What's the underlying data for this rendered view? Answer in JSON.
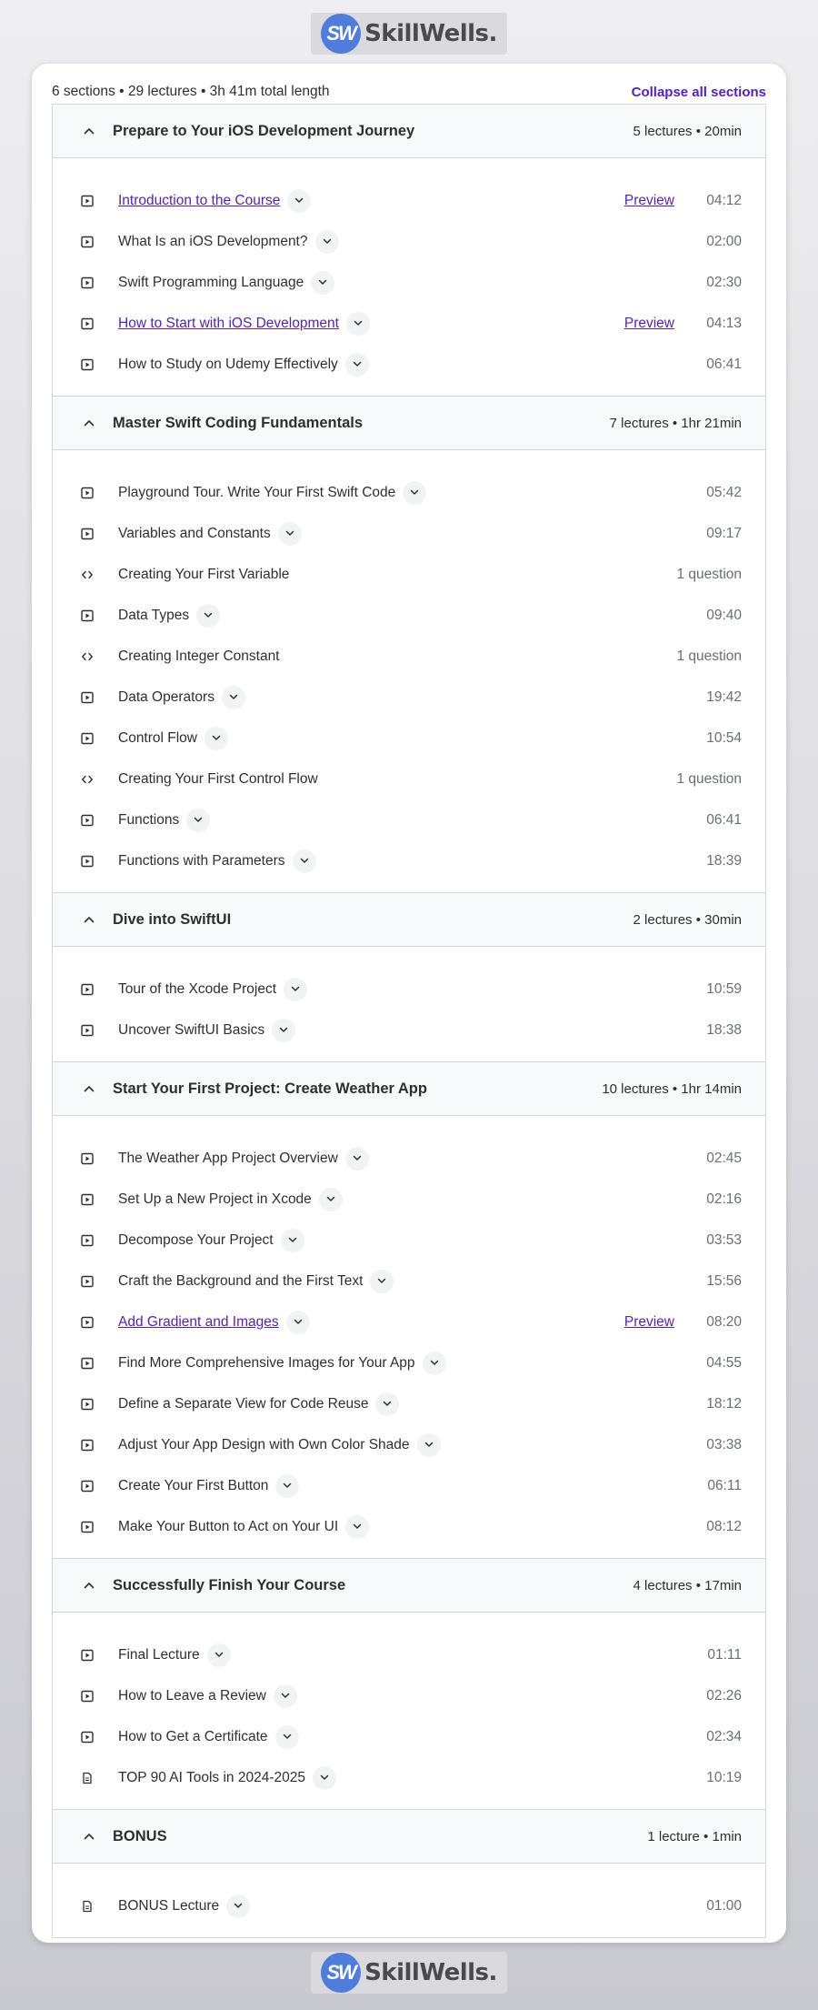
{
  "brand": {
    "mark": "SW",
    "name": "SkillWells."
  },
  "summary": {
    "text": "6 sections • 29 lectures • 3h 41m total length",
    "collapse_label": "Collapse all sections"
  },
  "sections": [
    {
      "title": "Prepare to Your iOS Development Journey",
      "meta": "5 lectures • 20min",
      "items": [
        {
          "icon": "video-icon",
          "title": "Introduction to the Course",
          "link": true,
          "preview": "Preview",
          "duration": "04:12"
        },
        {
          "icon": "video-icon",
          "title": "What Is an iOS Development?",
          "link": false,
          "preview": "",
          "duration": "02:00"
        },
        {
          "icon": "video-icon",
          "title": "Swift Programming Language",
          "link": false,
          "preview": "",
          "duration": "02:30"
        },
        {
          "icon": "video-icon",
          "title": "How to Start with iOS Development",
          "link": true,
          "preview": "Preview",
          "duration": "04:13"
        },
        {
          "icon": "video-icon",
          "title": "How to Study on Udemy Effectively",
          "link": false,
          "preview": "",
          "duration": "06:41"
        }
      ]
    },
    {
      "title": "Master Swift Coding Fundamentals",
      "meta": "7 lectures • 1hr 21min",
      "items": [
        {
          "icon": "video-icon",
          "title": "Playground Tour. Write Your First Swift Code",
          "link": false,
          "preview": "",
          "duration": "05:42"
        },
        {
          "icon": "video-icon",
          "title": "Variables and Constants",
          "link": false,
          "preview": "",
          "duration": "09:17"
        },
        {
          "icon": "code-icon",
          "title": "Creating Your First Variable",
          "link": false,
          "preview": "",
          "duration": "1 question",
          "nodrop": true
        },
        {
          "icon": "video-icon",
          "title": "Data Types",
          "link": false,
          "preview": "",
          "duration": "09:40"
        },
        {
          "icon": "code-icon",
          "title": "Creating Integer Constant",
          "link": false,
          "preview": "",
          "duration": "1 question",
          "nodrop": true
        },
        {
          "icon": "video-icon",
          "title": "Data Operators",
          "link": false,
          "preview": "",
          "duration": "19:42"
        },
        {
          "icon": "video-icon",
          "title": "Control Flow",
          "link": false,
          "preview": "",
          "duration": "10:54"
        },
        {
          "icon": "code-icon",
          "title": "Creating Your First Control Flow",
          "link": false,
          "preview": "",
          "duration": "1 question",
          "nodrop": true
        },
        {
          "icon": "video-icon",
          "title": "Functions",
          "link": false,
          "preview": "",
          "duration": "06:41"
        },
        {
          "icon": "video-icon",
          "title": "Functions with Parameters",
          "link": false,
          "preview": "",
          "duration": "18:39"
        }
      ]
    },
    {
      "title": "Dive into SwiftUI",
      "meta": "2 lectures • 30min",
      "items": [
        {
          "icon": "video-icon",
          "title": "Tour of the Xcode Project",
          "link": false,
          "preview": "",
          "duration": "10:59"
        },
        {
          "icon": "video-icon",
          "title": "Uncover SwiftUI Basics",
          "link": false,
          "preview": "",
          "duration": "18:38"
        }
      ]
    },
    {
      "title": "Start Your First Project: Create Weather App",
      "meta": "10 lectures • 1hr 14min",
      "items": [
        {
          "icon": "video-icon",
          "title": "The Weather App Project Overview",
          "link": false,
          "preview": "",
          "duration": "02:45"
        },
        {
          "icon": "video-icon",
          "title": "Set Up a New Project in Xcode",
          "link": false,
          "preview": "",
          "duration": "02:16"
        },
        {
          "icon": "video-icon",
          "title": "Decompose Your Project",
          "link": false,
          "preview": "",
          "duration": "03:53"
        },
        {
          "icon": "video-icon",
          "title": "Craft the Background and the First Text",
          "link": false,
          "preview": "",
          "duration": "15:56"
        },
        {
          "icon": "video-icon",
          "title": "Add Gradient and Images",
          "link": true,
          "preview": "Preview",
          "duration": "08:20"
        },
        {
          "icon": "video-icon",
          "title": "Find More Comprehensive Images for Your App",
          "link": false,
          "preview": "",
          "duration": "04:55"
        },
        {
          "icon": "video-icon",
          "title": "Define a Separate View for Code Reuse",
          "link": false,
          "preview": "",
          "duration": "18:12"
        },
        {
          "icon": "video-icon",
          "title": "Adjust Your App Design with Own Color Shade",
          "link": false,
          "preview": "",
          "duration": "03:38"
        },
        {
          "icon": "video-icon",
          "title": "Create Your First Button",
          "link": false,
          "preview": "",
          "duration": "06:11"
        },
        {
          "icon": "video-icon",
          "title": "Make Your Button to Act on Your UI",
          "link": false,
          "preview": "",
          "duration": "08:12"
        }
      ]
    },
    {
      "title": "Successfully Finish Your Course",
      "meta": "4 lectures • 17min",
      "items": [
        {
          "icon": "video-icon",
          "title": "Final Lecture",
          "link": false,
          "preview": "",
          "duration": "01:11"
        },
        {
          "icon": "video-icon",
          "title": "How to Leave a Review",
          "link": false,
          "preview": "",
          "duration": "02:26"
        },
        {
          "icon": "video-icon",
          "title": "How to Get a Certificate",
          "link": false,
          "preview": "",
          "duration": "02:34"
        },
        {
          "icon": "file-icon",
          "title": "TOP 90 AI Tools in 2024-2025",
          "link": false,
          "preview": "",
          "duration": "10:19"
        }
      ]
    },
    {
      "title": "BONUS",
      "meta": "1 lecture • 1min",
      "items": [
        {
          "icon": "file-icon",
          "title": "BONUS Lecture",
          "link": false,
          "preview": "",
          "duration": "01:00"
        }
      ]
    }
  ],
  "colors": {
    "accent": "#5022c3",
    "text": "#2d2f31",
    "muted": "#6a6f73",
    "border": "#d1d7dc",
    "header_bg": "#f7f9fa"
  }
}
